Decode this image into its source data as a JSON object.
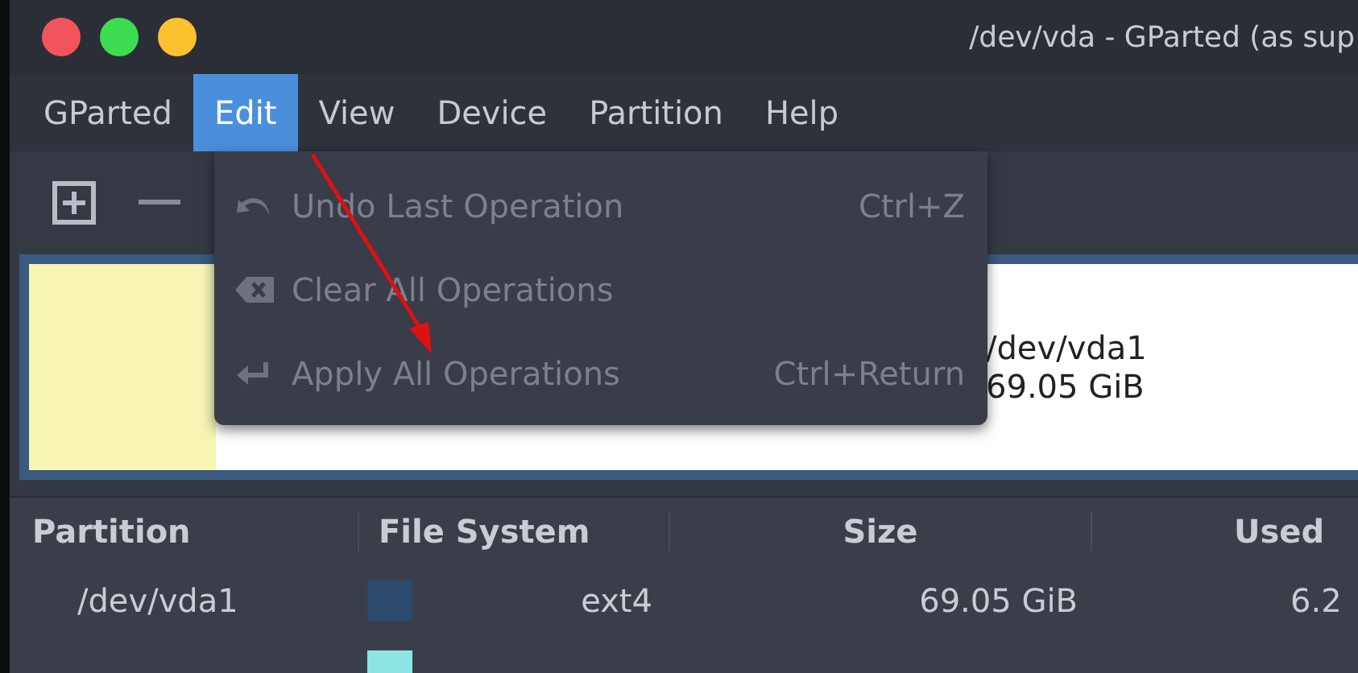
{
  "window": {
    "title": "/dev/vda - GParted (as sup"
  },
  "menubar": [
    {
      "label": "GParted",
      "selected": false
    },
    {
      "label": "Edit",
      "selected": true
    },
    {
      "label": "View",
      "selected": false
    },
    {
      "label": "Device",
      "selected": false
    },
    {
      "label": "Partition",
      "selected": false
    },
    {
      "label": "Help",
      "selected": false
    }
  ],
  "edit_menu": [
    {
      "label": "Undo Last Operation",
      "shortcut": "Ctrl+Z",
      "disabled": true,
      "kind": "undo"
    },
    {
      "label": "Clear All Operations",
      "disabled": true,
      "kind": "clear"
    },
    {
      "label": "Apply All Operations",
      "shortcut": "Ctrl+Return",
      "disabled": true,
      "kind": "apply"
    }
  ],
  "partition_graphic": {
    "name": "/dev/vda1",
    "size": "69.05 GiB"
  },
  "table": {
    "columns": [
      "Partition",
      "File System",
      "Size",
      "Used"
    ],
    "rows": [
      {
        "partition": "/dev/vda1",
        "filesystem": "ext4",
        "color": "#2c4a6b",
        "size": "69.05 GiB",
        "used": "6.2"
      },
      {
        "color": "#8ee3e3"
      }
    ]
  }
}
